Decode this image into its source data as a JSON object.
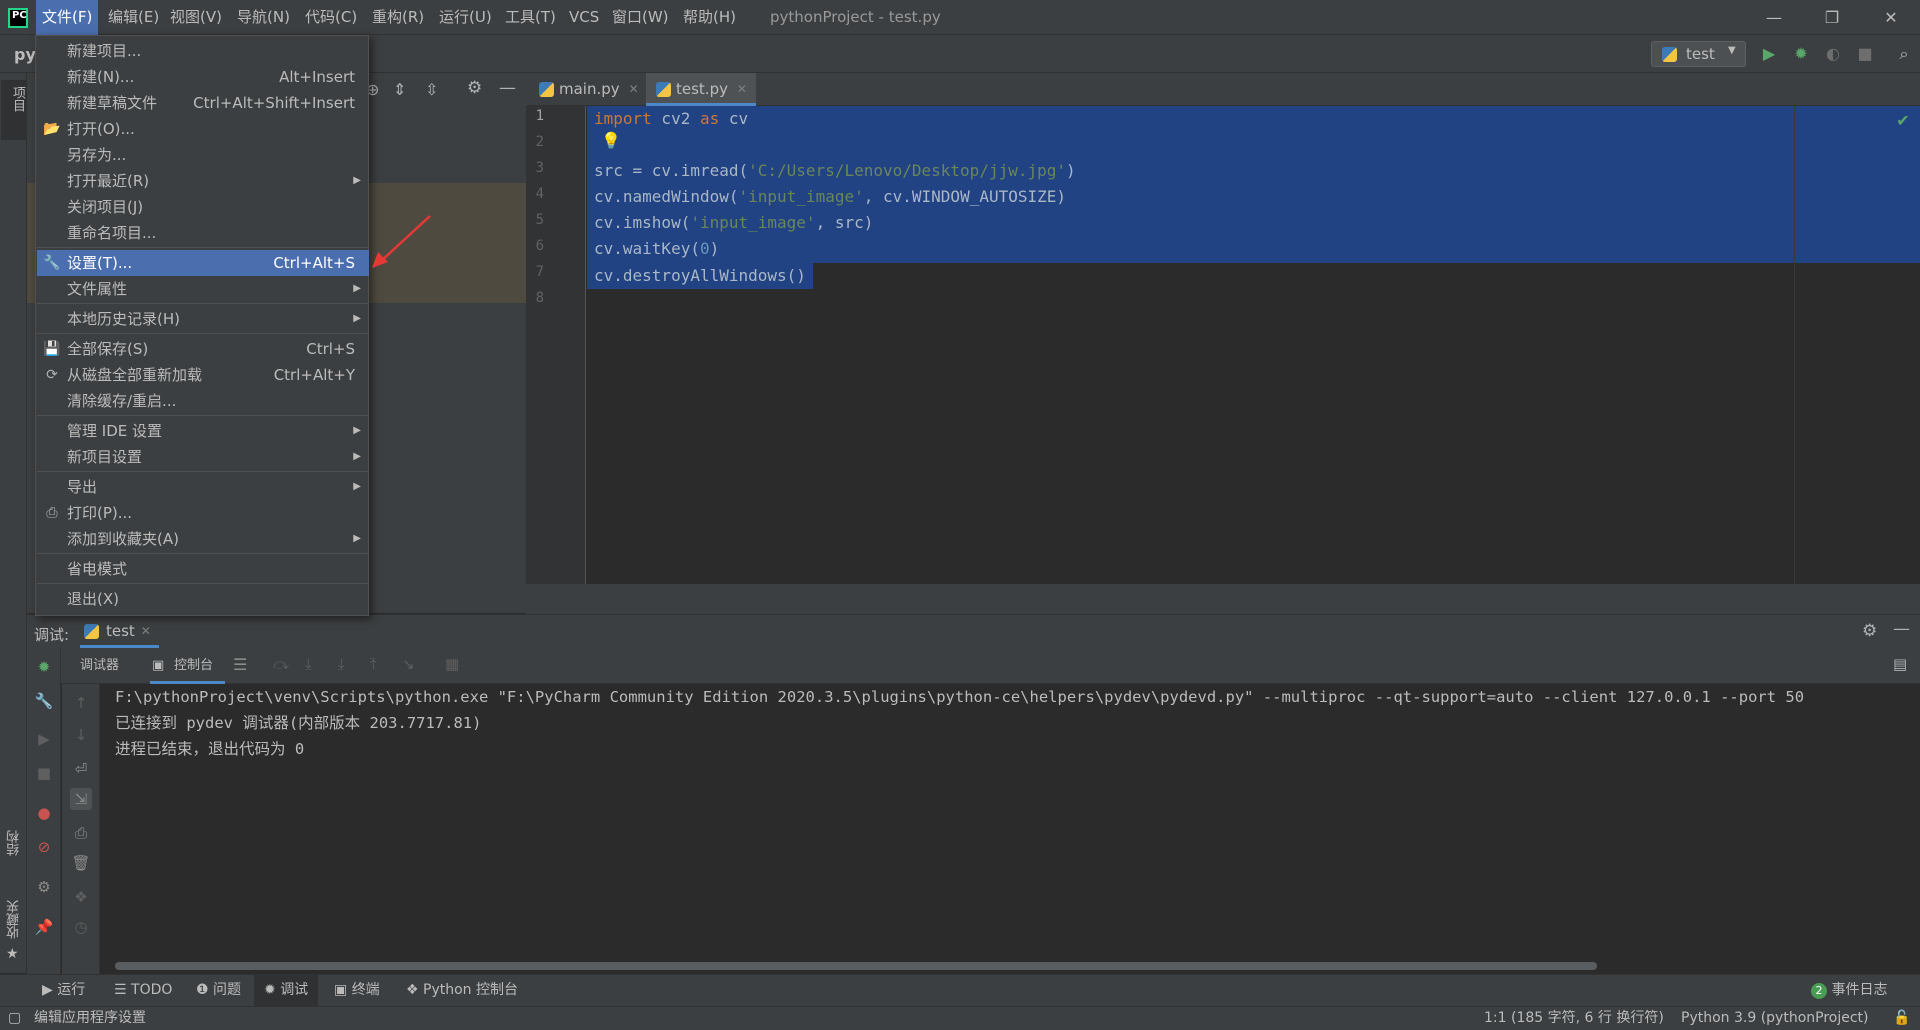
{
  "app": {
    "logo_text": "PC",
    "window_title": "pythonProject - test.py",
    "window_controls": {
      "minimize": "—",
      "restore": "❐",
      "close": "✕"
    }
  },
  "menubar": [
    {
      "label": "文件(F)",
      "active": true
    },
    {
      "label": "编辑(E)"
    },
    {
      "label": "视图(V)"
    },
    {
      "label": "导航(N)"
    },
    {
      "label": "代码(C)"
    },
    {
      "label": "重构(R)"
    },
    {
      "label": "运行(U)"
    },
    {
      "label": "工具(T)"
    },
    {
      "label": "VCS"
    },
    {
      "label": "窗口(W)"
    },
    {
      "label": "帮助(H)"
    }
  ],
  "toolbar": {
    "project_crumb": "py",
    "run_config": "test"
  },
  "file_menu": {
    "items": [
      {
        "label": "新建项目...",
        "shortcut": ""
      },
      {
        "label": "新建(N)...",
        "shortcut": "Alt+Insert"
      },
      {
        "label": "新建草稿文件",
        "shortcut": "Ctrl+Alt+Shift+Insert"
      },
      {
        "label": "打开(O)...",
        "shortcut": "",
        "icon": "folder-icon"
      },
      {
        "label": "另存为...",
        "shortcut": ""
      },
      {
        "label": "打开最近(R)",
        "submenu": true
      },
      {
        "label": "关闭项目(J)",
        "shortcut": ""
      },
      {
        "label": "重命名项目...",
        "shortcut": ""
      },
      {
        "label": "设置(T)...",
        "shortcut": "Ctrl+Alt+S",
        "active": true,
        "icon": "wrench-icon"
      },
      {
        "label": "文件属性",
        "submenu": true
      },
      {
        "label": "本地历史记录(H)",
        "submenu": true
      },
      {
        "label": "全部保存(S)",
        "shortcut": "Ctrl+S",
        "icon": "save-icon"
      },
      {
        "label": "从磁盘全部重新加载",
        "shortcut": "Ctrl+Alt+Y",
        "icon": "reload-icon"
      },
      {
        "label": "清除缓存/重启...",
        "shortcut": ""
      },
      {
        "label": "管理 IDE 设置",
        "submenu": true
      },
      {
        "label": "新项目设置",
        "submenu": true
      },
      {
        "label": "导出",
        "submenu": true
      },
      {
        "label": "打印(P)...",
        "shortcut": "",
        "icon": "print-icon"
      },
      {
        "label": "添加到收藏夹(A)",
        "submenu": true
      },
      {
        "label": "省电模式",
        "shortcut": ""
      },
      {
        "label": "退出(X)",
        "shortcut": ""
      }
    ]
  },
  "editor_tabs": [
    {
      "label": "main.py",
      "active": false
    },
    {
      "label": "test.py",
      "active": true
    }
  ],
  "editor": {
    "line_numbers": [
      "1",
      "2",
      "3",
      "4",
      "5",
      "6",
      "7",
      "8"
    ],
    "code": [
      "import cv2 as cv",
      "",
      "src = cv.imread('C:/Users/Lenovo/Desktop/jjw.jpg')",
      "cv.namedWindow('input_image', cv.WINDOW_AUTOSIZE)",
      "cv.imshow('input_image', src)",
      "cv.waitKey(0)",
      "cv.destroyAllWindows()",
      ""
    ],
    "code_tokens": {
      "l1_kw1": "import",
      "l1_mod": " cv2 ",
      "l1_kw2": "as",
      "l1_alias": " cv",
      "l3_a": "src = cv.imread(",
      "l3_s": "'C:/Users/Lenovo/Desktop/jjw.jpg'",
      "l3_b": ")",
      "l4_a": "cv.namedWindow(",
      "l4_s": "'input_image'",
      "l4_b": ", cv.WINDOW_AUTOSIZE)",
      "l5_a": "cv.imshow(",
      "l5_s": "'input_image'",
      "l5_b": ", src)",
      "l6_a": "cv.waitKey(",
      "l6_n": "0",
      "l6_b": ")",
      "l7": "cv.destroyAllWindows()"
    }
  },
  "debug_panel": {
    "title": "调试:",
    "session_tab": "test",
    "subtabs": {
      "debugger": "调试器",
      "console": "控制台"
    },
    "console_lines": [
      "F:\\pythonProject\\venv\\Scripts\\python.exe \"F:\\PyCharm Community Edition 2020.3.5\\plugins\\python-ce\\helpers\\pydev\\pydevd.py\" --multiproc --qt-support=auto --client 127.0.0.1 --port 50",
      "已连接到 pydev 调试器(内部版本 203.7717.81)",
      "进程已结束，退出代码为 0"
    ]
  },
  "left_strip": {
    "project": "项目",
    "structure": "结构",
    "favorites": "收藏夹"
  },
  "bottom_tabs": [
    {
      "label": "运行",
      "icon": "play-icon"
    },
    {
      "label": "TODO",
      "icon": "list-icon"
    },
    {
      "label": "问题",
      "icon": "info-icon"
    },
    {
      "label": "调试",
      "icon": "bug-icon",
      "active": true
    },
    {
      "label": "终端",
      "icon": "terminal-icon"
    },
    {
      "label": "Python 控制台",
      "icon": "python-icon"
    }
  ],
  "event_log": {
    "count": "2",
    "label": "事件日志"
  },
  "status_bar": {
    "message": "编辑应用程序设置",
    "position": "1:1 (185 字符, 6 行 换行符)",
    "interpreter": "Python 3.9 (pythonProject)"
  },
  "colors": {
    "accent": "#4b6eaf",
    "selection": "#214283",
    "keyword": "#cc7832",
    "string": "#6a8759",
    "number": "#6897bb",
    "annotation_arrow": "#e53935"
  }
}
